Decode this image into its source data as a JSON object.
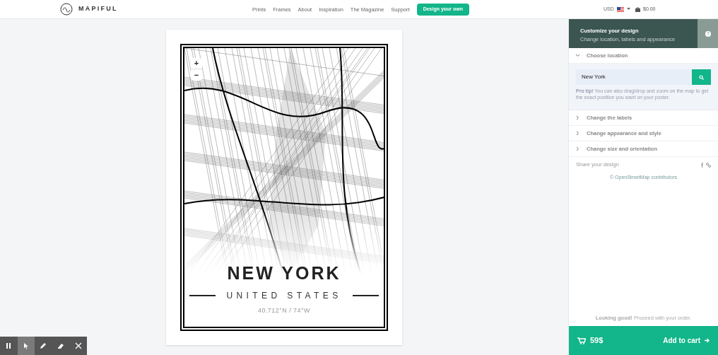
{
  "nav": {
    "logo": "MAPIFUL",
    "links": [
      "Prints",
      "Frames",
      "About",
      "Inspiration",
      "The Magazine",
      "Support"
    ],
    "cta": "Design your own",
    "currency": "USD",
    "cart": "$0.00"
  },
  "map": {
    "zoom_in": "+",
    "zoom_out": "−"
  },
  "poster": {
    "title": "NEW YORK",
    "subtitle": "UNITED STATES",
    "coordinates": "40.712°N / 74°W"
  },
  "panel": {
    "title": "Customize your design",
    "subtitle": "Change location, labels and appearance",
    "sections": [
      {
        "label": "Choose location",
        "expanded": true
      },
      {
        "label": "Change the labels",
        "expanded": false
      },
      {
        "label": "Change appearance and style",
        "expanded": false
      },
      {
        "label": "Change size and orientation",
        "expanded": false
      }
    ],
    "search": {
      "value": "New York"
    },
    "tip": "**Pro tip!** You can also drag/drop and zoom on the map to get the exact position you want on your poster.",
    "share": "Share your design",
    "attribution": "© OpenStreetMap contributors",
    "note": "**Looking good!** Proceed with your order.",
    "price": "59$",
    "add_to_cart": "Add to cart"
  },
  "toolbar": [
    {
      "kind": "pause",
      "selected": false
    },
    {
      "kind": "pointer",
      "selected": true
    },
    {
      "kind": "pen",
      "selected": false
    },
    {
      "kind": "eraser",
      "selected": false
    },
    {
      "kind": "close",
      "selected": false
    }
  ]
}
